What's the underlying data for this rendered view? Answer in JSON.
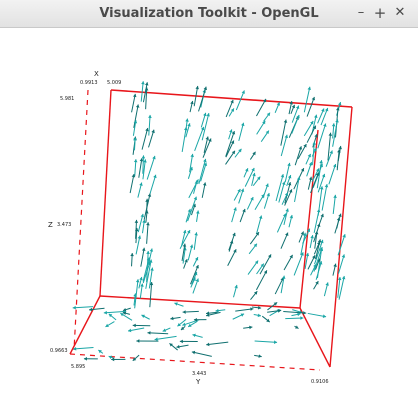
{
  "window": {
    "title": "Visualization Toolkit - OpenGL",
    "minimize_symbol": "–",
    "maximize_symbol": "+",
    "close_symbol": "✕"
  },
  "axes": {
    "x_axis": {
      "name": "X",
      "min_label": "0.9913",
      "max_label": "5.009"
    },
    "y_axis": {
      "name": "Y",
      "min_label": "5.895",
      "mid_label": "3.443",
      "max_label": "0.9106"
    },
    "z_axis": {
      "name": "Z",
      "min_label": "0.9663",
      "mid_label": "3.473",
      "max_label": "5.981"
    }
  },
  "colors": {
    "box": "#e8161b",
    "glyphs": "#1aa6a6",
    "glyphs_dark": "#0f6f6f",
    "background": "#ffffff"
  },
  "icons": [
    "minimize-icon",
    "maximize-icon",
    "close-icon"
  ]
}
